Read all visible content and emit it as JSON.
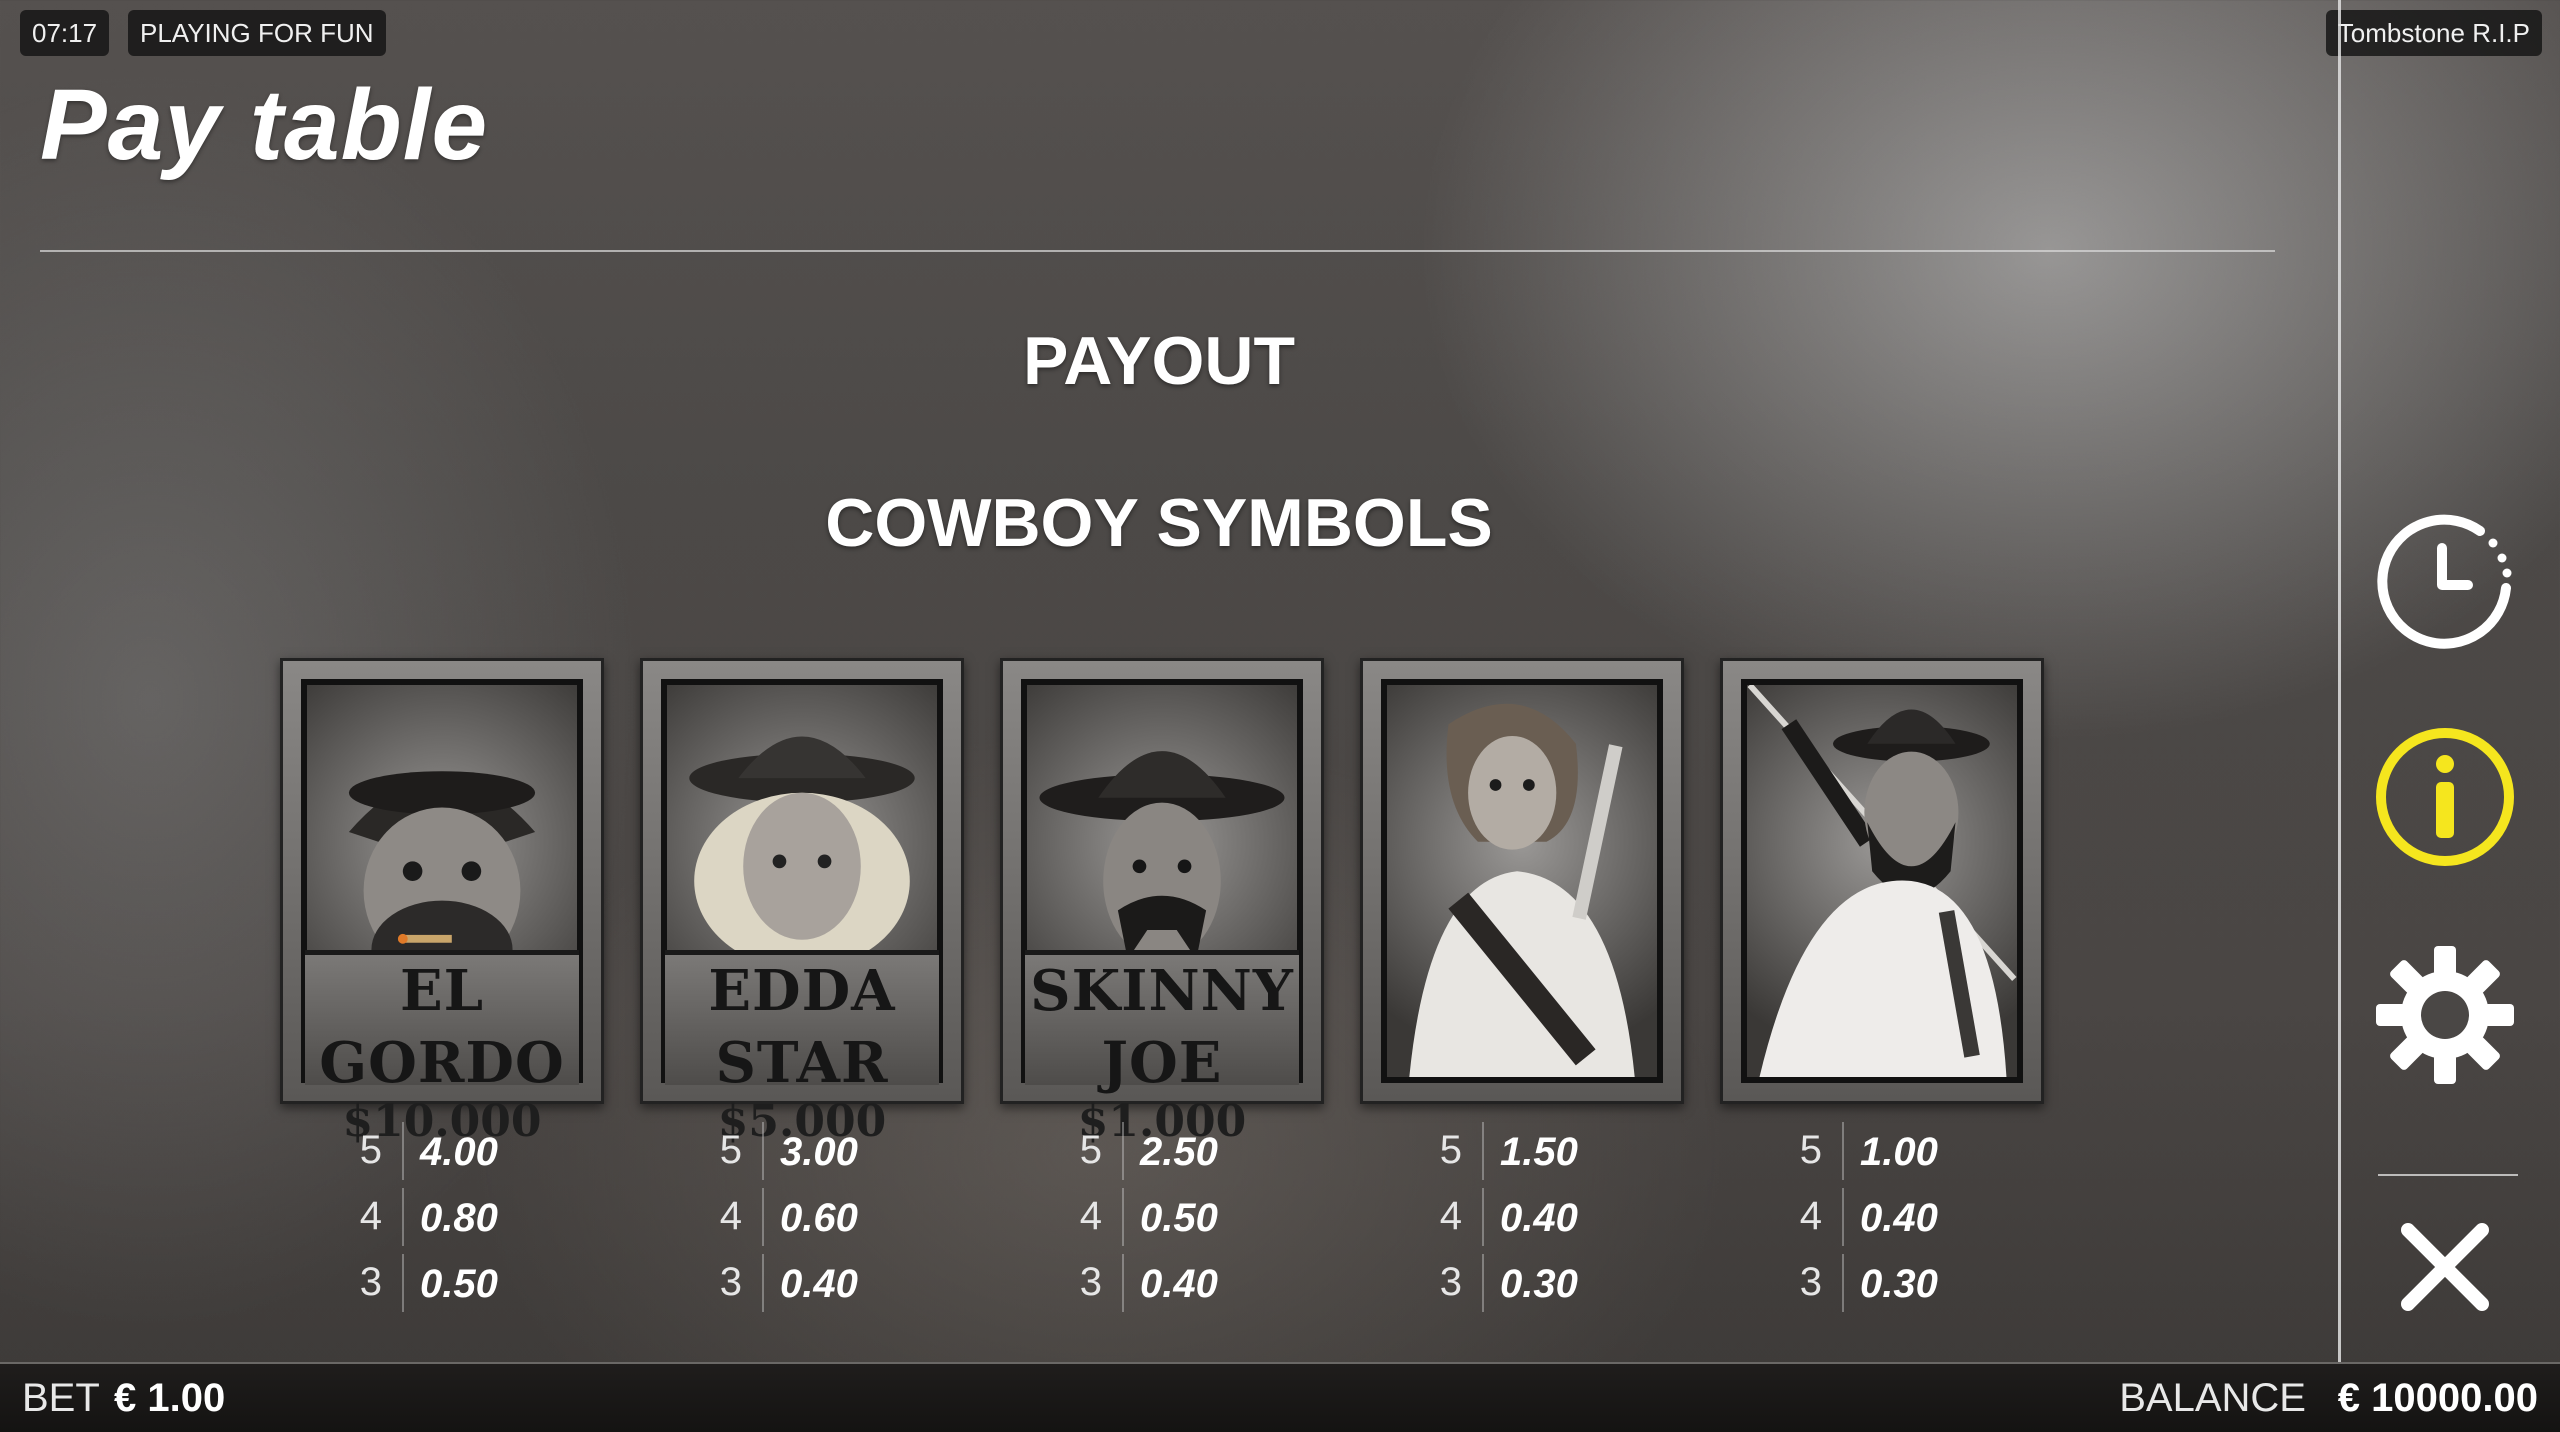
{
  "status_bar": {
    "time": "07:17",
    "mode": "PLAYING FOR FUN",
    "game_name": "Tombstone R.I.P"
  },
  "page": {
    "title": "Pay table",
    "payout_heading": "PAYOUT",
    "section_heading": "COWBOY SYMBOLS"
  },
  "symbols": [
    {
      "id": "el-gordo",
      "poster_name": "EL GORDO",
      "bounty": "$10.000",
      "payouts": [
        {
          "count": "5",
          "amount": "4.00"
        },
        {
          "count": "4",
          "amount": "0.80"
        },
        {
          "count": "3",
          "amount": "0.50"
        }
      ]
    },
    {
      "id": "edda-star",
      "poster_name": "EDDA STAR",
      "bounty": "$5.000",
      "payouts": [
        {
          "count": "5",
          "amount": "3.00"
        },
        {
          "count": "4",
          "amount": "0.60"
        },
        {
          "count": "3",
          "amount": "0.40"
        }
      ]
    },
    {
      "id": "skinny-joe",
      "poster_name": "SKINNY JOE",
      "bounty": "$1.000",
      "payouts": [
        {
          "count": "5",
          "amount": "2.50"
        },
        {
          "count": "4",
          "amount": "0.50"
        },
        {
          "count": "3",
          "amount": "0.40"
        }
      ]
    },
    {
      "id": "gunslinger-woman",
      "payouts": [
        {
          "count": "5",
          "amount": "1.50"
        },
        {
          "count": "4",
          "amount": "0.40"
        },
        {
          "count": "3",
          "amount": "0.30"
        }
      ]
    },
    {
      "id": "bearded-outlaw",
      "payouts": [
        {
          "count": "5",
          "amount": "1.00"
        },
        {
          "count": "4",
          "amount": "0.40"
        },
        {
          "count": "3",
          "amount": "0.30"
        }
      ]
    }
  ],
  "side_menu": {
    "icons": [
      "history-icon",
      "info-icon",
      "settings-icon",
      "close-icon"
    ],
    "info_color": "#f5e61e"
  },
  "bottom_bar": {
    "bet_label": "BET",
    "bet_value": "€ 1.00",
    "balance_label": "BALANCE",
    "balance_value": "€ 10000.00"
  }
}
